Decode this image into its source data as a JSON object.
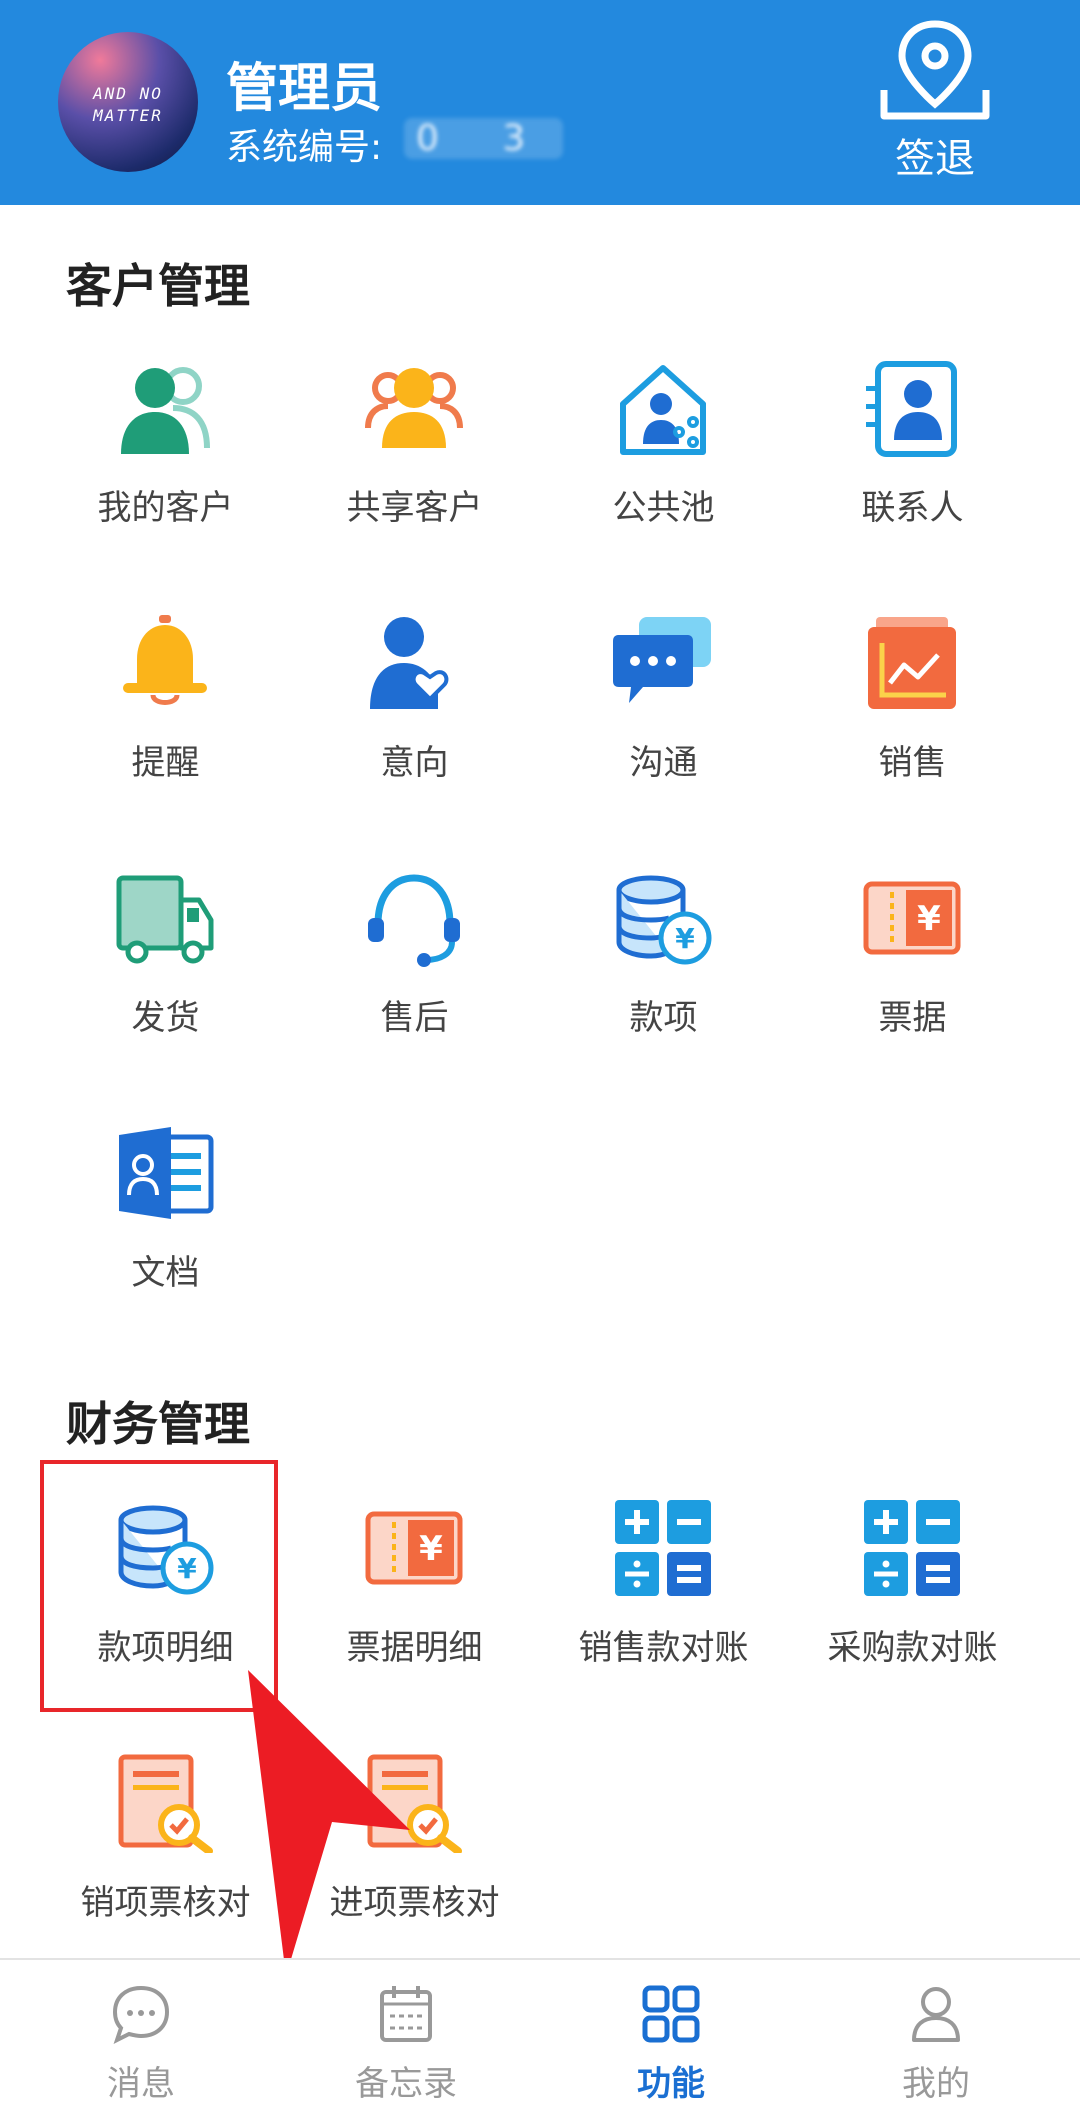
{
  "header": {
    "avatar_text_line1": "AND NO",
    "avatar_text_line2": "MATTER",
    "user_name": "管理员",
    "system_id_label": "系统编号:",
    "system_id_value": "0    3",
    "signout_label": "签退"
  },
  "customer_section": {
    "title": "客户管理",
    "items": [
      {
        "label": "我的客户",
        "icon": "my-customers-icon"
      },
      {
        "label": "共享客户",
        "icon": "shared-customers-icon"
      },
      {
        "label": "公共池",
        "icon": "public-pool-icon"
      },
      {
        "label": "联系人",
        "icon": "contacts-icon"
      },
      {
        "label": "提醒",
        "icon": "bell-icon"
      },
      {
        "label": "意向",
        "icon": "intent-icon"
      },
      {
        "label": "沟通",
        "icon": "chat-icon"
      },
      {
        "label": "销售",
        "icon": "sales-chart-icon"
      },
      {
        "label": "发货",
        "icon": "truck-icon"
      },
      {
        "label": "售后",
        "icon": "headset-icon"
      },
      {
        "label": "款项",
        "icon": "coins-icon"
      },
      {
        "label": "票据",
        "icon": "ticket-icon"
      },
      {
        "label": "文档",
        "icon": "document-icon"
      }
    ]
  },
  "finance_section": {
    "title": "财务管理",
    "items": [
      {
        "label": "款项明细",
        "icon": "coins-icon"
      },
      {
        "label": "票据明细",
        "icon": "ticket-icon"
      },
      {
        "label": "销售款对账",
        "icon": "calculator-icon"
      },
      {
        "label": "采购款对账",
        "icon": "calculator-icon"
      },
      {
        "label": "销项票核对",
        "icon": "invoice-check-icon"
      },
      {
        "label": "进项票核对",
        "icon": "invoice-check-icon"
      }
    ]
  },
  "bottom_nav": {
    "items": [
      {
        "label": "消息",
        "icon": "message-icon"
      },
      {
        "label": "备忘录",
        "icon": "calendar-icon"
      },
      {
        "label": "功能",
        "icon": "grid-icon",
        "active": true
      },
      {
        "label": "我的",
        "icon": "profile-icon"
      }
    ]
  },
  "colors": {
    "header_bg": "#2389de",
    "active_tab": "#1a6fd2",
    "highlight": "#e8262a"
  }
}
